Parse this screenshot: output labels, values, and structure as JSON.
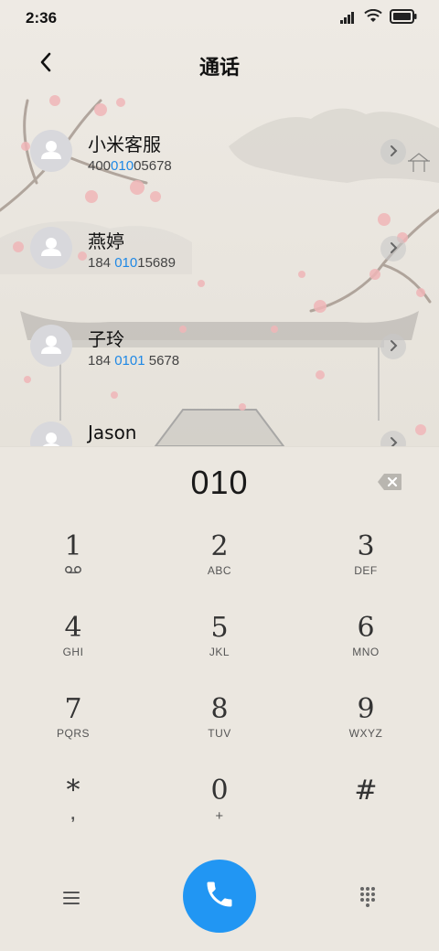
{
  "status_bar": {
    "time": "2:36",
    "icons": [
      "signal-icon",
      "wifi-icon",
      "battery-icon"
    ]
  },
  "header": {
    "title": "通话",
    "back_icon": "chevron-left-icon"
  },
  "contacts": [
    {
      "name": "小米客服",
      "number_pre": "400",
      "number_match": "010",
      "number_post": "05678"
    },
    {
      "name": "燕婷",
      "number_pre": "184 ",
      "number_match": "010",
      "number_post": "15689"
    },
    {
      "name": "子玲",
      "number_pre": "184 ",
      "number_match": "0101",
      "number_post": " 5678"
    },
    {
      "name": "Jason",
      "number_pre": "",
      "number_match": "",
      "number_post": ""
    }
  ],
  "dialer": {
    "input": "010",
    "keys": [
      {
        "digit": "1",
        "letters": ""
      },
      {
        "digit": "2",
        "letters": "ABC"
      },
      {
        "digit": "3",
        "letters": "DEF"
      },
      {
        "digit": "4",
        "letters": "GHI"
      },
      {
        "digit": "5",
        "letters": "JKL"
      },
      {
        "digit": "6",
        "letters": "MNO"
      },
      {
        "digit": "7",
        "letters": "PQRS"
      },
      {
        "digit": "8",
        "letters": "TUV"
      },
      {
        "digit": "9",
        "letters": "WXYZ"
      },
      {
        "digit": "*",
        "letters": ","
      },
      {
        "digit": "0",
        "letters": "+"
      },
      {
        "digit": "#",
        "letters": ""
      }
    ]
  },
  "colors": {
    "accent": "#2196f3",
    "match_highlight": "#1e88e5",
    "background": "#ebe7e0"
  }
}
